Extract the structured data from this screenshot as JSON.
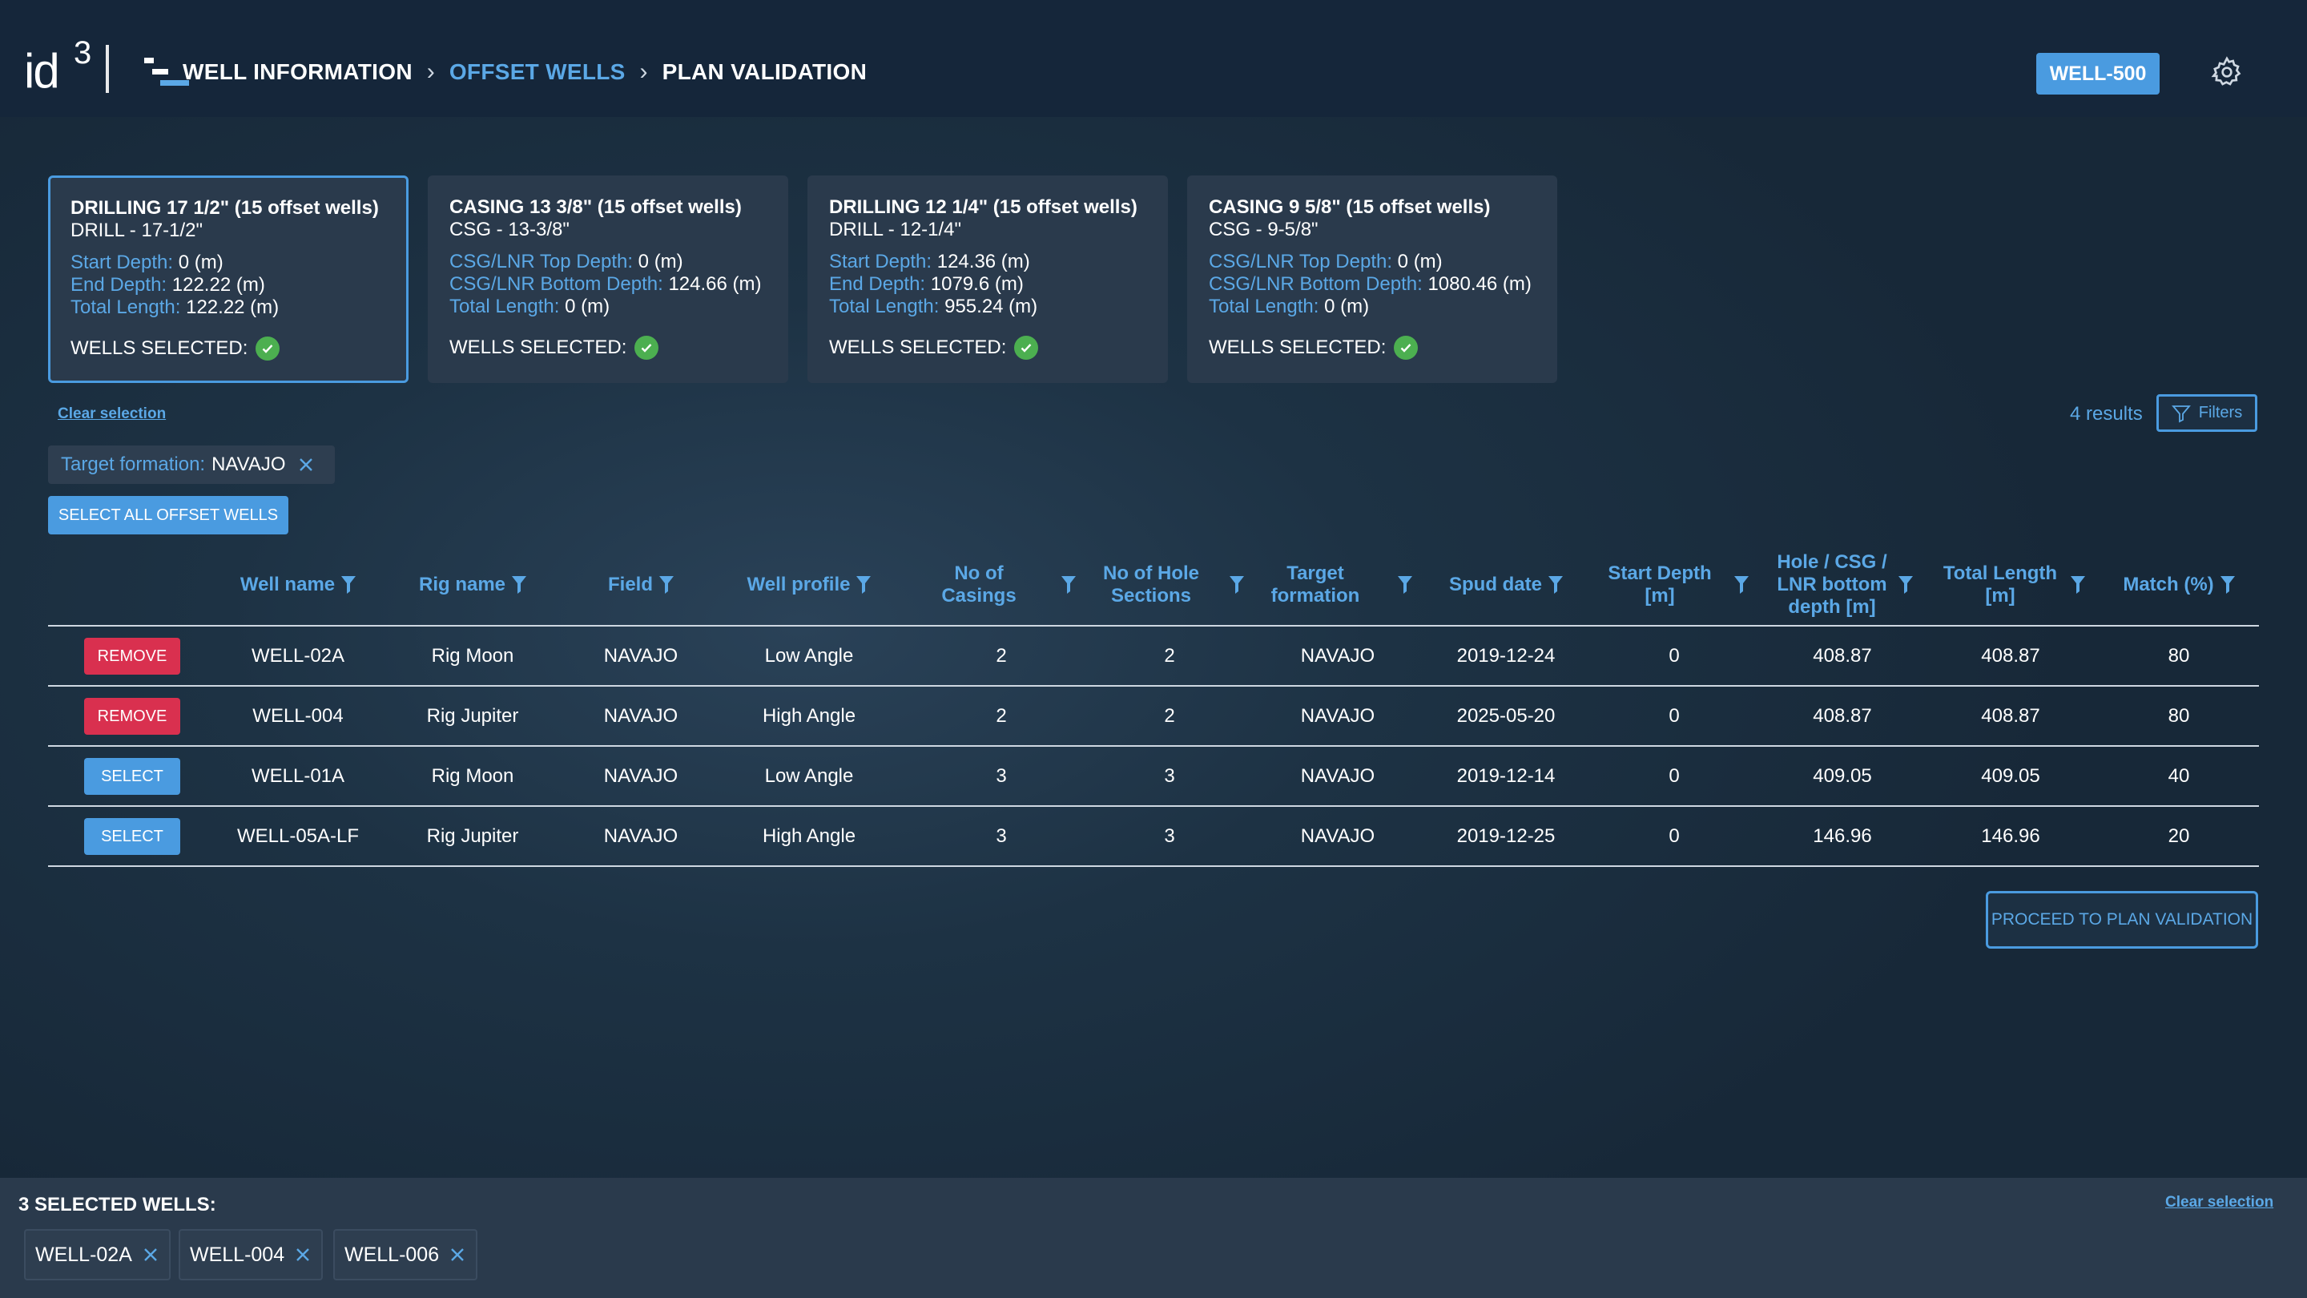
{
  "header": {
    "logo_text": "id",
    "logo_sup": "3",
    "breadcrumb": [
      "WELL INFORMATION",
      "OFFSET WELLS",
      "PLAN VALIDATION"
    ],
    "well_badge": "WELL-500",
    "icons": {
      "settings": "gear-icon",
      "breadcrumb_sep": "chevron-right-icon"
    }
  },
  "cards": [
    {
      "title": "DRILLING 17 1/2\" (15 offset wells)",
      "subtitle": "DRILL - 17-1/2\"",
      "l1_key": "Start Depth:",
      "l1_val": "0 (m)",
      "l2_key": "End Depth:",
      "l2_val": "122.22 (m)",
      "l3_key": "Total Length:",
      "l3_val": "122.22 (m)",
      "selected_label": "WELLS SELECTED:"
    },
    {
      "title": "CASING 13 3/8\" (15 offset wells)",
      "subtitle": "CSG - 13-3/8\"",
      "l1_key": "CSG/LNR Top Depth:",
      "l1_val": "0 (m)",
      "l2_key": "CSG/LNR Bottom Depth:",
      "l2_val": "124.66 (m)",
      "l3_key": "Total Length:",
      "l3_val": "0 (m)",
      "selected_label": "WELLS SELECTED:"
    },
    {
      "title": "DRILLING 12 1/4\" (15 offset wells)",
      "subtitle": "DRILL - 12-1/4\"",
      "l1_key": "Start Depth:",
      "l1_val": "124.36 (m)",
      "l2_key": "End Depth:",
      "l2_val": "1079.6 (m)",
      "l3_key": "Total Length:",
      "l3_val": "955.24 (m)",
      "selected_label": "WELLS SELECTED:"
    },
    {
      "title": "CASING 9 5/8\" (15 offset wells)",
      "subtitle": "CSG - 9-5/8\"",
      "l1_key": "CSG/LNR Top Depth:",
      "l1_val": "0 (m)",
      "l2_key": "CSG/LNR Bottom Depth:",
      "l2_val": "1080.46 (m)",
      "l3_key": "Total Length:",
      "l3_val": "0 (m)",
      "selected_label": "WELLS SELECTED:"
    }
  ],
  "toolbar": {
    "clear_selection": "Clear selection",
    "results": "4 results",
    "filters": "Filters",
    "filter_chip_key": "Target formation:",
    "filter_chip_val": "NAVAJO",
    "select_all": "SELECT ALL OFFSET WELLS"
  },
  "table": {
    "headers": [
      "Well name",
      "Rig name",
      "Field",
      "Well profile",
      "No of Casings",
      "No of Hole Sections",
      "Target formation",
      "Spud date",
      "Start Depth [m]",
      "Hole / CSG / LNR bottom depth [m]",
      "Total Length [m]",
      "Match (%)"
    ],
    "headers_display": [
      "Well name",
      "Rig name",
      "Field",
      "Well profile",
      "No of\nCasings",
      "No of Hole\nSections",
      "Target\nformation",
      "Spud date",
      "Start Depth\n[m]",
      "Hole / CSG /\nLNR bottom\ndepth [m]",
      "Total Length\n[m]",
      "Match (%)"
    ],
    "rows": [
      {
        "action": "REMOVE",
        "cells": [
          "WELL-02A",
          "Rig Moon",
          "NAVAJO",
          "Low Angle",
          "2",
          "2",
          "NAVAJO",
          "2019-12-24",
          "0",
          "408.87",
          "408.87",
          "80"
        ]
      },
      {
        "action": "REMOVE",
        "cells": [
          "WELL-004",
          "Rig Jupiter",
          "NAVAJO",
          "High Angle",
          "2",
          "2",
          "NAVAJO",
          "2025-05-20",
          "0",
          "408.87",
          "408.87",
          "80"
        ]
      },
      {
        "action": "SELECT",
        "cells": [
          "WELL-01A",
          "Rig Moon",
          "NAVAJO",
          "Low Angle",
          "3",
          "3",
          "NAVAJO",
          "2019-12-14",
          "0",
          "409.05",
          "409.05",
          "40"
        ]
      },
      {
        "action": "SELECT",
        "cells": [
          "WELL-05A-LF",
          "Rig Jupiter",
          "NAVAJO",
          "High Angle",
          "3",
          "3",
          "NAVAJO",
          "2019-12-25",
          "0",
          "146.96",
          "146.96",
          "20"
        ]
      }
    ]
  },
  "proceed": "PROCEED TO PLAN VALIDATION",
  "footer": {
    "title": "3 SELECTED WELLS:",
    "clear_selection": "Clear selection",
    "chips": [
      "WELL-02A",
      "WELL-004",
      "WELL-006"
    ]
  },
  "colors": {
    "accent": "#4a9be0",
    "link": "#5ba8e6",
    "danger": "#d9304f",
    "success": "#4caf50",
    "card_bg": "#2a3a4c"
  }
}
